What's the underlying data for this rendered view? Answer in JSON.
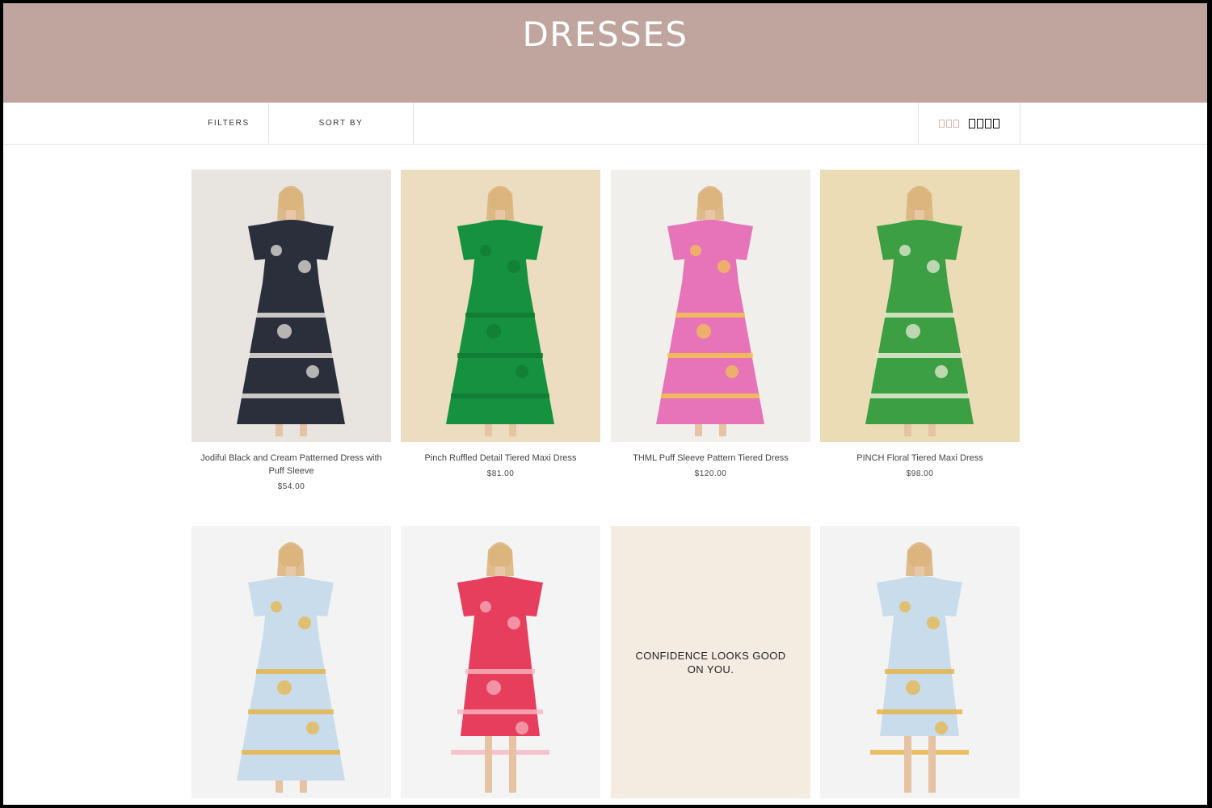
{
  "collection": {
    "title": "DRESSES"
  },
  "toolbar": {
    "filters_label": "FILTERS",
    "sort_label": "SORT BY"
  },
  "products": [
    {
      "name": "Jodiful Black and Cream Patterned Dress with Puff Sleeve",
      "price": "$54.00",
      "bg": "#e8e4df",
      "dress": "#2b2f3c",
      "accent": "#f2eee6"
    },
    {
      "name": "Pinch Ruffled Detail Tiered Maxi Dress",
      "price": "$81.00",
      "bg": "#ecdcc0",
      "dress": "#16913f",
      "accent": "#0f7a33"
    },
    {
      "name": "THML Puff Sleeve Pattern Tiered Dress",
      "price": "$120.00",
      "bg": "#f1efec",
      "dress": "#e774b8",
      "accent": "#f2c94c"
    },
    {
      "name": "PINCH Floral Tiered Maxi Dress",
      "price": "$98.00",
      "bg": "#ebdcb6",
      "dress": "#3c9f44",
      "accent": "#f4f1de"
    },
    {
      "name": "",
      "price": "",
      "bg": "#f3f3f3",
      "dress": "#c8dcec",
      "accent": "#e8b340"
    },
    {
      "name": "",
      "price": "",
      "bg": "#f4f4f4",
      "dress": "#e83e5e",
      "accent": "#f7b7c3"
    },
    {
      "name": "",
      "price": "",
      "bg": "#f3f3f3",
      "dress": "#c8dcec",
      "accent": "#e8b340"
    }
  ],
  "promo": {
    "text": "CONFIDENCE LOOKS GOOD ON YOU."
  }
}
